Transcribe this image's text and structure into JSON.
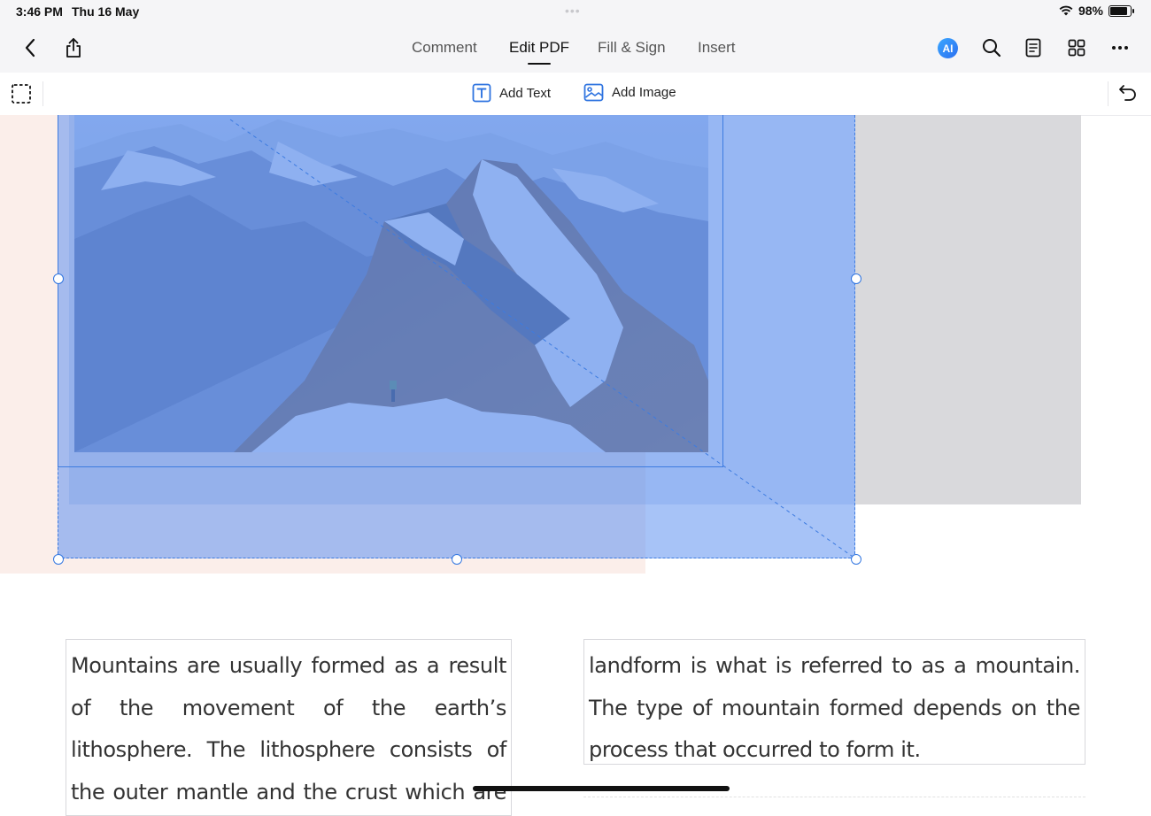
{
  "status_bar": {
    "time": "3:46 PM",
    "date": "Thu 16 May",
    "battery": "98%",
    "dots": "•••"
  },
  "nav": {
    "tabs": [
      {
        "label": "Comment"
      },
      {
        "label": "Edit PDF"
      },
      {
        "label": "Fill & Sign"
      },
      {
        "label": "Insert"
      }
    ],
    "active_tab": "Edit PDF",
    "ai_label": "AI",
    "icons": [
      "back-chevron-icon",
      "share-icon",
      "ai-icon",
      "search-icon",
      "document-outline-icon",
      "grid-icon",
      "more-icon"
    ]
  },
  "toolbar": {
    "add_text": "Add Text",
    "add_image": "Add Image",
    "icons": [
      "marquee-select-icon",
      "text-box-icon",
      "image-icon",
      "undo-icon"
    ]
  },
  "document": {
    "left_paragraph": "Mountains are usually formed as a result of the movement of the earth’s lithosphere. The lithosphere consists of the outer mantle and the crust which are also referred to as",
    "right_paragraph": "landform is what is referred to as a mountain. The type of mountain formed depends on the process that occurred to form it."
  },
  "colors": {
    "selection": "#5f91f0",
    "accent": "#2f74e0",
    "pink_background": "#fbeeea",
    "grey_block": "#d9d9dc"
  }
}
